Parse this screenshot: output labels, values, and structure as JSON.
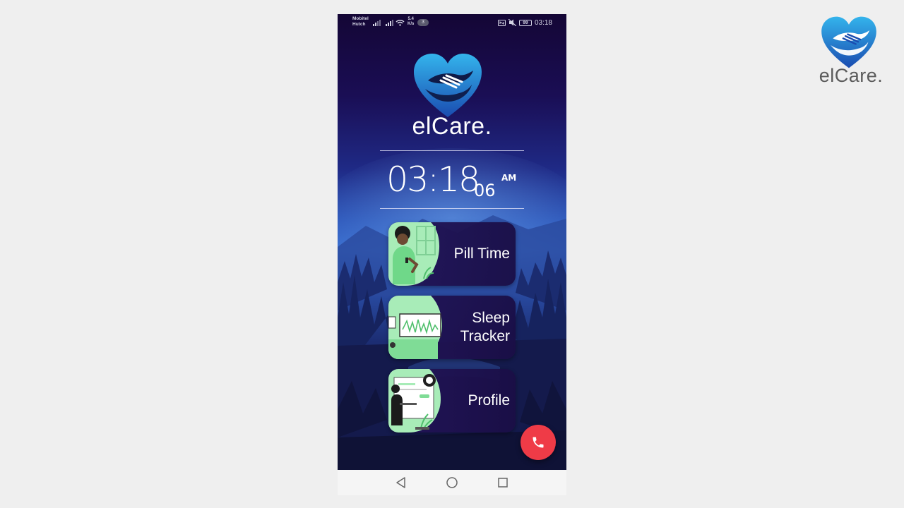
{
  "brand": {
    "name": "elCare.",
    "heart_color_top": "#2fa8e6",
    "heart_color_bottom": "#1b4fb4"
  },
  "status_bar": {
    "carrier_line1": "Mobitel",
    "carrier_line2": "Hutch",
    "net_speed_value": "5.4",
    "net_speed_unit": "K/s",
    "notification_count": "3",
    "battery": "99",
    "time": "03:18"
  },
  "clock": {
    "hours_minutes": "03:18",
    "seconds": "06",
    "ampm": "AM"
  },
  "menu": [
    {
      "label": "Pill Time",
      "icon": "pill-time-illustration"
    },
    {
      "label": "Sleep\nTracker",
      "icon": "sleep-tracker-illustration"
    },
    {
      "label": "Profile",
      "icon": "profile-illustration"
    }
  ],
  "call_button": {
    "icon": "phone-icon",
    "color": "#ef3b47"
  },
  "nav": {
    "back_icon": "back-triangle-icon",
    "home_icon": "home-circle-icon",
    "recents_icon": "recents-square-icon"
  }
}
